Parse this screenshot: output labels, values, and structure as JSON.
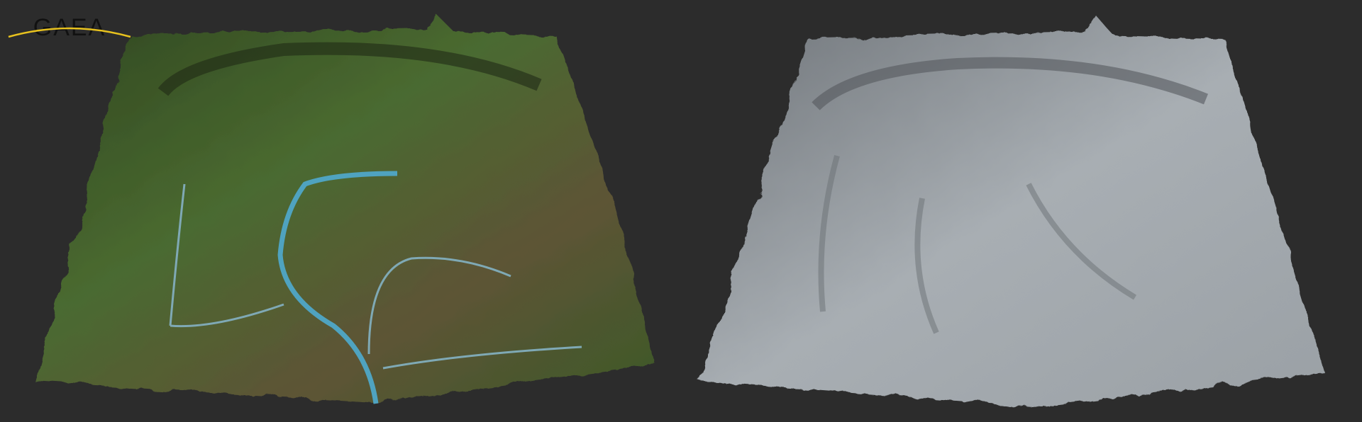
{
  "logo": {
    "text": "GAEA",
    "arc_color": "#e8c21e",
    "text_color": "#111111"
  },
  "colors": {
    "background": "#2c2c2c",
    "water": "#4fa3c0",
    "grass": "#3e5a2a",
    "rock": "#7a5a40",
    "clay": "#9aa0a6"
  },
  "panels": [
    {
      "name": "textured-terrain"
    },
    {
      "name": "clay-terrain"
    }
  ]
}
